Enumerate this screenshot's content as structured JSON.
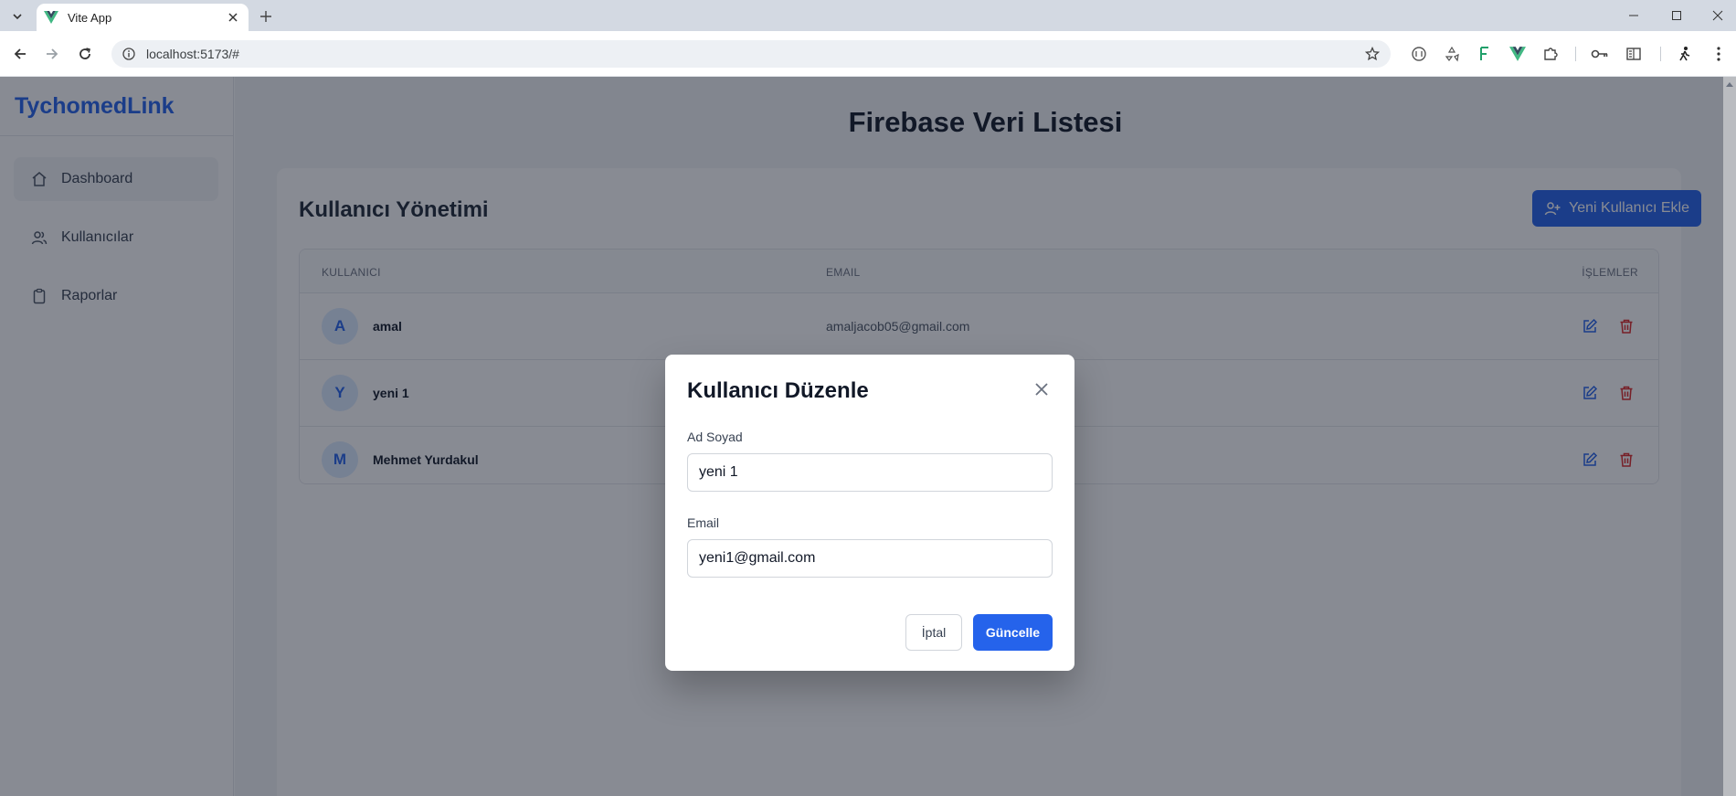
{
  "browser": {
    "tab_title": "Vite App",
    "url": "localhost:5173/#"
  },
  "app": {
    "brand": "TychomedLink",
    "sidebar": {
      "items": [
        {
          "label": "Dashboard",
          "icon": "home-icon",
          "active": true
        },
        {
          "label": "Kullanıcılar",
          "icon": "users-icon",
          "active": false
        },
        {
          "label": "Raporlar",
          "icon": "clipboard-icon",
          "active": false
        }
      ]
    },
    "page_title": "Firebase Veri Listesi",
    "panel": {
      "title": "Kullanıcı Yönetimi",
      "add_button": "Yeni Kullanıcı Ekle"
    },
    "table": {
      "headers": {
        "user": "KULLANICI",
        "email": "EMAIL",
        "actions": "İŞLEMLER"
      },
      "rows": [
        {
          "initial": "A",
          "name": "amal",
          "email": "amaljacob05@gmail.com"
        },
        {
          "initial": "Y",
          "name": "yeni 1",
          "email": ""
        },
        {
          "initial": "M",
          "name": "Mehmet Yurdakul",
          "email": ""
        }
      ]
    }
  },
  "modal": {
    "title": "Kullanıcı Düzenle",
    "name_label": "Ad Soyad",
    "name_value": "yeni 1",
    "email_label": "Email",
    "email_value": "yeni1@gmail.com",
    "cancel": "İptal",
    "submit": "Güncelle"
  },
  "colors": {
    "primary": "#2563eb",
    "danger": "#dc2626",
    "overlay": "rgba(17,24,39,0.5)"
  }
}
